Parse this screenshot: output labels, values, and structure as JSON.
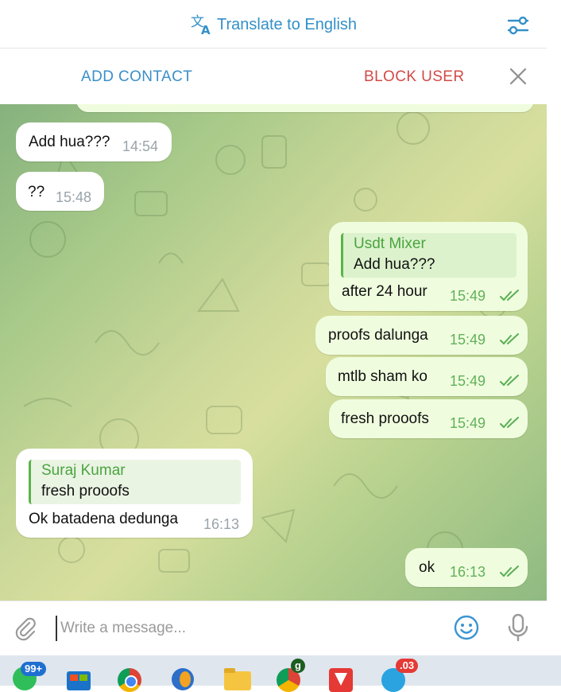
{
  "translate_bar": {
    "label": "Translate to English",
    "icon": "translate-icon",
    "settings_icon": "sliders-icon",
    "accent": "#3390c8"
  },
  "actions": {
    "add_contact": "ADD CONTACT",
    "block_user": "BLOCK USER",
    "close_icon": "close-icon",
    "add_color": "#3a8fc9",
    "block_color": "#d14a47"
  },
  "messages": [
    {
      "direction": "in",
      "text": "Add hua???",
      "time": "14:54"
    },
    {
      "direction": "in",
      "text": "??",
      "time": "15:48"
    },
    {
      "direction": "out",
      "reply_to": {
        "name": "Usdt Mixer",
        "text": "Add hua???"
      },
      "text": "after 24 hour",
      "time": "15:49",
      "status": "read"
    },
    {
      "direction": "out",
      "text": "proofs dalunga",
      "time": "15:49",
      "status": "read"
    },
    {
      "direction": "out",
      "text": "mtlb sham ko",
      "time": "15:49",
      "status": "read"
    },
    {
      "direction": "out",
      "text": "fresh prooofs",
      "time": "15:49",
      "status": "read"
    },
    {
      "direction": "in",
      "reply_to": {
        "name": "Suraj Kumar",
        "text": "fresh prooofs"
      },
      "text": "Ok batadena dedunga",
      "time": "16:13"
    },
    {
      "direction": "out",
      "text": "ok",
      "time": "16:13",
      "status": "read"
    }
  ],
  "composer": {
    "placeholder": "Write a message...",
    "value": "",
    "attach_icon": "paperclip-icon",
    "emoji_icon": "smiley-icon",
    "mic_icon": "microphone-icon"
  },
  "taskbar": {
    "icons": [
      "whatsapp-icon",
      "microsoft-store-icon",
      "chrome-icon",
      "media-player-icon",
      "file-explorer-icon",
      "chrome-profile-icon",
      "app-icon",
      "telegram-icon"
    ],
    "badges": {
      "whatsapp": "99+",
      "chrome_profile": "g",
      "telegram": ".03"
    }
  }
}
